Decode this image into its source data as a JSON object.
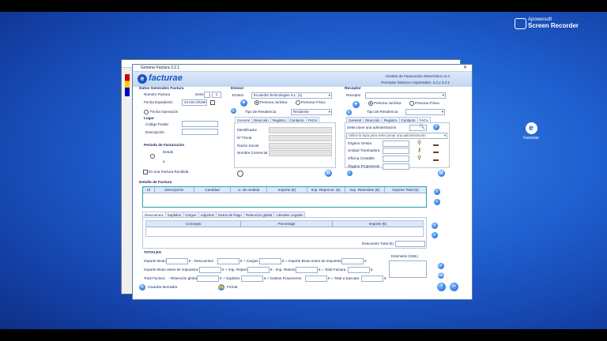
{
  "recorder": {
    "brand": "Apowersoft",
    "product": "Screen Recorder"
  },
  "desktop_icon": {
    "label": "Facturae"
  },
  "window": {
    "title": "Generar Factura 3.2.1",
    "close": "✕"
  },
  "header": {
    "line1": "Gestión de Facturación Electrónica v3.4",
    "line2": "Formatos factura-e soportados: 3.2 y 3.2.1",
    "logo": "factura",
    "logo_letter": "e"
  },
  "generales": {
    "title": "Datos Generales Factura",
    "numero_label": "Número Factura",
    "serie": "Serie",
    "numero": "1",
    "fecha_exp_label": "Fecha Expedición",
    "fecha_exp": "24-ene-2016",
    "fecha_op_label": "Fecha Operación",
    "lugar_label": "Lugar",
    "cp_label": "Código Postal",
    "desc_label": "Descripción",
    "periodo_label": "Periodo de Facturación",
    "desde_label": "Desde",
    "hasta_label": "a",
    "recibida_label": "Es una Factura Recibida"
  },
  "emisor": {
    "title": "Emisor",
    "emisor_label": "Emisor",
    "emisor_value": "Ecoandra Technologies S.L. (1)",
    "juridica": "Persona Jurídica",
    "fisica": "Persona Física",
    "residencia_label": "Tipo de Residencia",
    "residencia_value": "Residente",
    "tabs": [
      "General",
      "Dirección",
      "Registro",
      "Contacto",
      "FACe"
    ],
    "fields": [
      "Identificador",
      "Nº Fiscal",
      "Razón Social",
      "Nombre Comercial"
    ]
  },
  "receptor": {
    "title": "Receptor",
    "receptor_label": "Receptor",
    "juridica": "Persona Jurídica",
    "fisica": "Persona Física",
    "residencia_label": "Tipo de Residencia",
    "tabs": [
      "General",
      "Dirección",
      "Registro",
      "Contacto",
      "FACe"
    ],
    "sel_admin": "Seleccione una administración",
    "admin_placeholder": "Utilice la lupa para seleccionar una administración",
    "fields": [
      "Órgano Gestor",
      "Unidad Tramitadora",
      "Oficina Contable",
      "Órgano Proponente"
    ]
  },
  "detalle": {
    "title": "Detalle de Factura",
    "columns": [
      "Id",
      "Descripción",
      "Cantidad",
      "U. de medida",
      "Importe (€)",
      "Imp. Repercut. (€)",
      "Imp. Retenidos (€)",
      "Importe Total (€)"
    ]
  },
  "sub": {
    "tabs": [
      "Descuentos",
      "Suplidos",
      "Cargos",
      "Adjuntos",
      "Datos de Pago",
      "Retención global",
      "Literales Legales"
    ],
    "columns": [
      "Concepto",
      "Porcentaje",
      "Importe (€)"
    ],
    "total_label": "Descuento Total (€)"
  },
  "totales": {
    "title": "TOTALES",
    "extension": "Extensión (XML)",
    "row1": [
      "Importe Bruto",
      "€ - Descuentos",
      "€ + Cargos",
      "€ = Importe Bruto antes de impuestos",
      "€"
    ],
    "row2": [
      "Importe Bruto antes de impuestos",
      "€ + Imp. Repercut.",
      "€ - Imp. Retenidos",
      "€ = Total Factura",
      "€"
    ],
    "row3": [
      "Total Factura",
      "- Retención global",
      "€ + Suplidos",
      "€ + Gastos Financieros",
      "€ = Total a Ejecutar",
      "€"
    ]
  },
  "footer": {
    "save": "Guardar Borrador",
    "sign": "Firmar"
  }
}
